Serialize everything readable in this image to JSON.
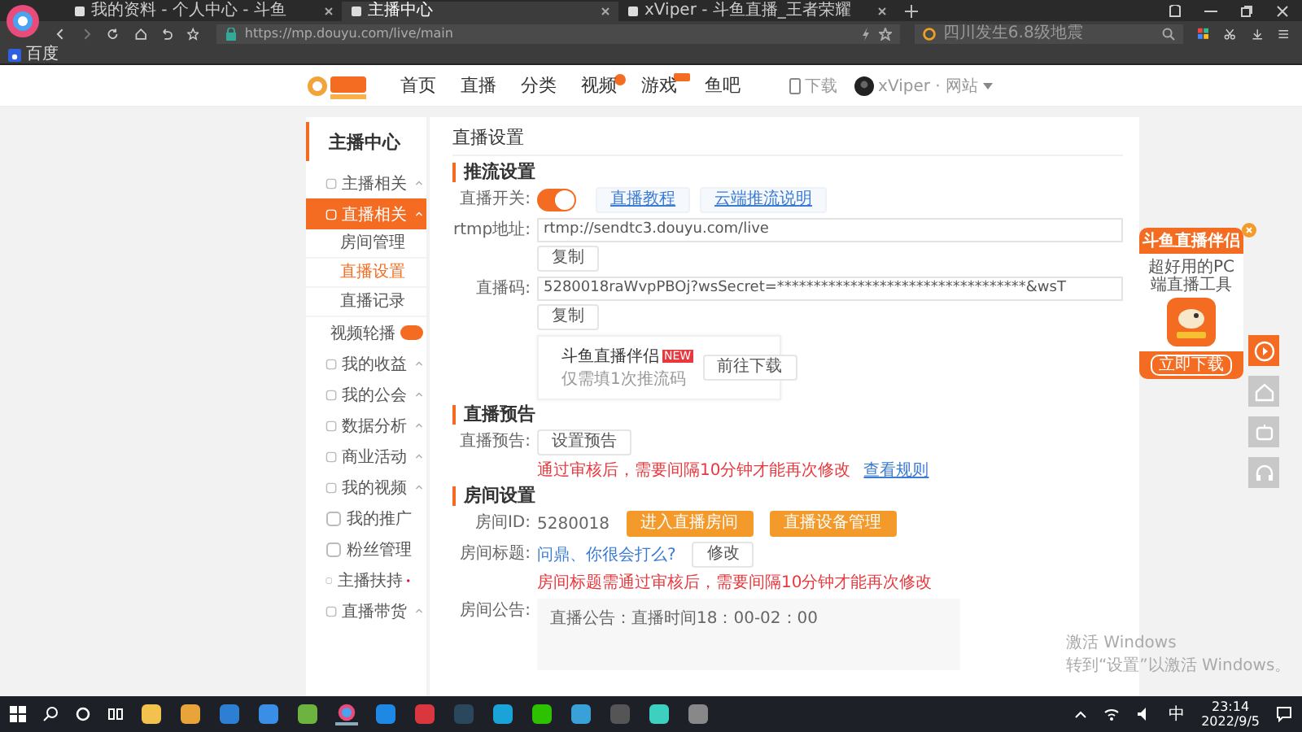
{
  "browser": {
    "tabs": [
      {
        "title": "我的资料 - 个人中心 - 斗鱼",
        "selected": false
      },
      {
        "title": "主播中心",
        "selected": true
      },
      {
        "title": "xViper - 斗鱼直播_王者荣耀",
        "selected": false
      }
    ],
    "url": "https://mp.douyu.com/live/main",
    "search_placeholder": "四川发生6.8级地震",
    "bookmarks": [
      "百度"
    ]
  },
  "site_nav": {
    "items": [
      {
        "label": "首页",
        "kind": "plain"
      },
      {
        "label": "直播",
        "kind": "plain"
      },
      {
        "label": "分类",
        "kind": "plain"
      },
      {
        "label": "视频",
        "kind": "dot"
      },
      {
        "label": "游戏",
        "kind": "tag"
      },
      {
        "label": "鱼吧",
        "kind": "plain"
      }
    ],
    "download": "下载",
    "user": "xViper · 网站"
  },
  "sidebar": {
    "title": "主播中心",
    "items": [
      {
        "label": "主播相关",
        "kind": "group",
        "selected": false
      },
      {
        "label": "直播相关",
        "kind": "group",
        "selected": true,
        "children": [
          {
            "label": "房间管理",
            "selected": false
          },
          {
            "label": "直播设置",
            "selected": true
          },
          {
            "label": "直播记录",
            "selected": false
          }
        ]
      },
      {
        "label": "视频轮播",
        "kind": "link",
        "selected": false,
        "badge": true
      },
      {
        "label": "我的收益",
        "kind": "group",
        "selected": false
      },
      {
        "label": "我的公会",
        "kind": "group",
        "selected": false
      },
      {
        "label": "数据分析",
        "kind": "group",
        "selected": false
      },
      {
        "label": "商业活动",
        "kind": "group",
        "selected": false
      },
      {
        "label": "我的视频",
        "kind": "group",
        "selected": false
      },
      {
        "label": "我的推广",
        "kind": "link",
        "selected": false
      },
      {
        "label": "粉丝管理",
        "kind": "link",
        "selected": false
      },
      {
        "label": "主播扶持",
        "kind": "link",
        "selected": false,
        "dot": true
      },
      {
        "label": "直播带货",
        "kind": "group",
        "selected": false
      }
    ]
  },
  "main": {
    "title": "直播设置",
    "sections": [
      {
        "title": "推流设置",
        "rows": [
          {
            "kind": "toggle",
            "label": "直播开关:",
            "on": true,
            "links": [
              "直播教程",
              "云端推流说明"
            ]
          },
          {
            "kind": "field",
            "label": "rtmp地址:",
            "value": "rtmp://sendtc3.douyu.com/live",
            "button": "复制"
          },
          {
            "kind": "field",
            "label": "直播码:",
            "value": "5280018raWvpPBOj?wsSecret=**********************************&wsT",
            "button": "复制"
          },
          {
            "kind": "promo",
            "title": "斗鱼直播伴侣",
            "badge": "NEW",
            "subtitle": "仅需填1次推流码",
            "button": "前往下载"
          }
        ]
      },
      {
        "title": "直播预告",
        "rows": [
          {
            "kind": "action",
            "label": "直播预告:",
            "buttons": [
              {
                "label": "设置预告",
                "kind": "plain"
              }
            ],
            "note": "通过审核后，需要间隔10分钟才能再次修改",
            "note_link": "查看规则"
          }
        ]
      },
      {
        "title": "房间设置",
        "rows": [
          {
            "kind": "action",
            "label": "房间ID:",
            "value": "5280018",
            "buttons": [
              {
                "label": "进入直播房间",
                "kind": "primary"
              },
              {
                "label": "直播设备管理",
                "kind": "primary"
              }
            ]
          },
          {
            "kind": "action",
            "label": "房间标题:",
            "value": "问鼎、你很会打么?",
            "value_link": true,
            "buttons": [
              {
                "label": "修改",
                "kind": "plain"
              }
            ],
            "note": "房间标题需通过审核后，需要间隔10分钟才能再次修改"
          },
          {
            "kind": "textarea",
            "label": "房间公告:",
            "value": "直播公告：直播时间18：00-02：00"
          }
        ]
      }
    ]
  },
  "ad": {
    "title": "斗鱼直播伴侣",
    "subtitle": "超好用的PC端直播工具",
    "button": "立即下载"
  },
  "activation": {
    "title": "激活 Windows",
    "subtitle": "转到“设置”以激活 Windows。"
  },
  "taskbar": {
    "ime": "中",
    "time": "23:14",
    "date": "2022/9/5"
  }
}
